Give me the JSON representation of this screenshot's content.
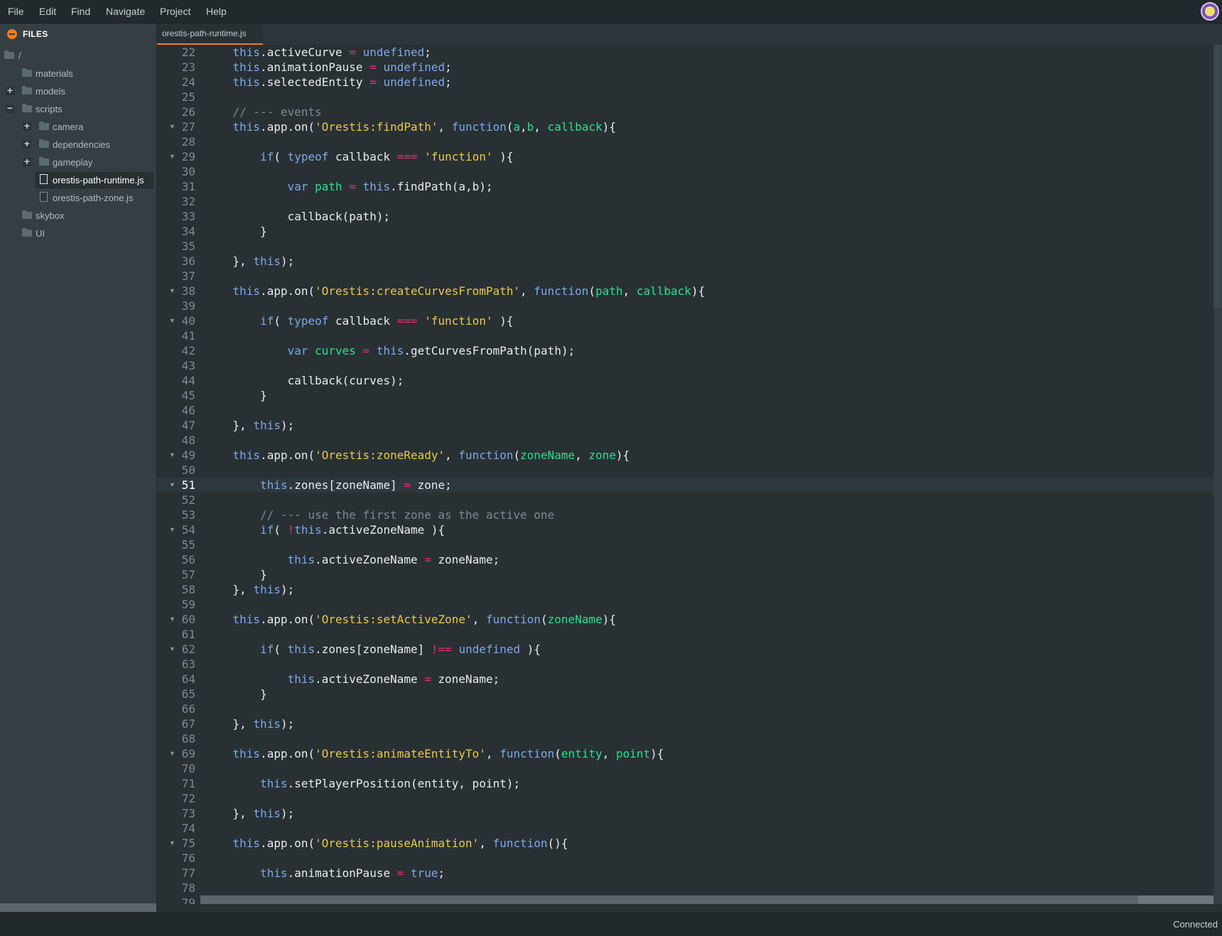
{
  "menubar": {
    "items": [
      "File",
      "Edit",
      "Find",
      "Navigate",
      "Project",
      "Help"
    ]
  },
  "sidebar": {
    "title": "FILES",
    "tree": [
      {
        "label": "/",
        "kind": "folder",
        "depth": 0,
        "toggle": "",
        "icon": "folder-icon"
      },
      {
        "label": "materials",
        "kind": "folder",
        "depth": 1,
        "toggle": "",
        "icon": "folder-icon"
      },
      {
        "label": "models",
        "kind": "folder",
        "depth": 1,
        "toggle": "+",
        "icon": "folder-icon"
      },
      {
        "label": "scripts",
        "kind": "folder",
        "depth": 1,
        "toggle": "−",
        "icon": "folder-icon"
      },
      {
        "label": "camera",
        "kind": "folder",
        "depth": 2,
        "toggle": "+",
        "icon": "folder-icon"
      },
      {
        "label": "dependencies",
        "kind": "folder",
        "depth": 2,
        "toggle": "+",
        "icon": "folder-icon"
      },
      {
        "label": "gameplay",
        "kind": "folder",
        "depth": 2,
        "toggle": "+",
        "icon": "folder-icon"
      },
      {
        "label": "orestis-path-runtime.js",
        "kind": "file",
        "depth": 2,
        "toggle": "",
        "icon": "file-icon",
        "selected": true
      },
      {
        "label": "orestis-path-zone.js",
        "kind": "file",
        "depth": 2,
        "toggle": "",
        "icon": "file-icon"
      },
      {
        "label": "skybox",
        "kind": "folder",
        "depth": 1,
        "toggle": "",
        "icon": "folder-icon"
      },
      {
        "label": "UI",
        "kind": "folder",
        "depth": 1,
        "toggle": "",
        "icon": "folder-icon"
      }
    ]
  },
  "tabs": [
    {
      "label": "orestis-path-runtime.js",
      "active": true
    }
  ],
  "editor": {
    "active_line": 51,
    "lines": [
      {
        "n": 22,
        "fold": false,
        "html": "    <span class=\"kw\">this</span>.activeCurve <span class=\"op\">=</span> <span class=\"kw\">undefined</span>;"
      },
      {
        "n": 23,
        "fold": false,
        "html": "    <span class=\"kw\">this</span>.animationPause <span class=\"op\">=</span> <span class=\"kw\">undefined</span>;"
      },
      {
        "n": 24,
        "fold": false,
        "html": "    <span class=\"kw\">this</span>.selectedEntity <span class=\"op\">=</span> <span class=\"kw\">undefined</span>;"
      },
      {
        "n": 25,
        "fold": false,
        "html": ""
      },
      {
        "n": 26,
        "fold": false,
        "html": "    <span class=\"cmt\">// --- events</span>"
      },
      {
        "n": 27,
        "fold": true,
        "html": "    <span class=\"kw\">this</span>.app.on(<span class=\"str\">'Orestis:findPath'</span>, <span class=\"kw\">function</span>(<span class=\"prm\">a</span>,<span class=\"prm\">b</span>, <span class=\"prm\">callback</span>){"
      },
      {
        "n": 28,
        "fold": false,
        "html": ""
      },
      {
        "n": 29,
        "fold": true,
        "html": "        <span class=\"kw\">if</span>( <span class=\"kw\">typeof</span> callback <span class=\"op\">===</span> <span class=\"str\">'function'</span> ){"
      },
      {
        "n": 30,
        "fold": false,
        "html": ""
      },
      {
        "n": 31,
        "fold": false,
        "html": "            <span class=\"kw\">var</span> <span class=\"prm\">path</span> <span class=\"op\">=</span> <span class=\"kw\">this</span>.findPath(a,b);"
      },
      {
        "n": 32,
        "fold": false,
        "html": ""
      },
      {
        "n": 33,
        "fold": false,
        "html": "            callback(path);"
      },
      {
        "n": 34,
        "fold": false,
        "html": "        }"
      },
      {
        "n": 35,
        "fold": false,
        "html": ""
      },
      {
        "n": 36,
        "fold": false,
        "html": "    }, <span class=\"kw\">this</span>);"
      },
      {
        "n": 37,
        "fold": false,
        "html": ""
      },
      {
        "n": 38,
        "fold": true,
        "html": "    <span class=\"kw\">this</span>.app.on(<span class=\"str\">'Orestis:createCurvesFromPath'</span>, <span class=\"kw\">function</span>(<span class=\"prm\">path</span>, <span class=\"prm\">callback</span>){"
      },
      {
        "n": 39,
        "fold": false,
        "html": ""
      },
      {
        "n": 40,
        "fold": true,
        "html": "        <span class=\"kw\">if</span>( <span class=\"kw\">typeof</span> callback <span class=\"op\">===</span> <span class=\"str\">'function'</span> ){"
      },
      {
        "n": 41,
        "fold": false,
        "html": ""
      },
      {
        "n": 42,
        "fold": false,
        "html": "            <span class=\"kw\">var</span> <span class=\"prm\">curves</span> <span class=\"op\">=</span> <span class=\"kw\">this</span>.getCurvesFromPath(path);"
      },
      {
        "n": 43,
        "fold": false,
        "html": ""
      },
      {
        "n": 44,
        "fold": false,
        "html": "            callback(curves);"
      },
      {
        "n": 45,
        "fold": false,
        "html": "        }"
      },
      {
        "n": 46,
        "fold": false,
        "html": ""
      },
      {
        "n": 47,
        "fold": false,
        "html": "    }, <span class=\"kw\">this</span>);"
      },
      {
        "n": 48,
        "fold": false,
        "html": ""
      },
      {
        "n": 49,
        "fold": true,
        "html": "    <span class=\"kw\">this</span>.app.on(<span class=\"str\">'Orestis:zoneReady'</span>, <span class=\"kw\">function</span>(<span class=\"prm\">zoneName</span>, <span class=\"prm\">zone</span>){"
      },
      {
        "n": 50,
        "fold": false,
        "html": ""
      },
      {
        "n": 51,
        "fold": true,
        "html": "        <span class=\"kw\">this</span>.zones[zoneName] <span class=\"op\">=</span> zone;"
      },
      {
        "n": 52,
        "fold": false,
        "html": ""
      },
      {
        "n": 53,
        "fold": false,
        "html": "        <span class=\"cmt\">// --- use the first zone as the active one</span>"
      },
      {
        "n": 54,
        "fold": true,
        "html": "        <span class=\"kw\">if</span>( <span class=\"op\">!</span><span class=\"kw\">this</span>.activeZoneName ){"
      },
      {
        "n": 55,
        "fold": false,
        "html": ""
      },
      {
        "n": 56,
        "fold": false,
        "html": "            <span class=\"kw\">this</span>.activeZoneName <span class=\"op\">=</span> zoneName;"
      },
      {
        "n": 57,
        "fold": false,
        "html": "        }"
      },
      {
        "n": 58,
        "fold": false,
        "html": "    }, <span class=\"kw\">this</span>);"
      },
      {
        "n": 59,
        "fold": false,
        "html": ""
      },
      {
        "n": 60,
        "fold": true,
        "html": "    <span class=\"kw\">this</span>.app.on(<span class=\"str\">'Orestis:setActiveZone'</span>, <span class=\"kw\">function</span>(<span class=\"prm\">zoneName</span>){"
      },
      {
        "n": 61,
        "fold": false,
        "html": ""
      },
      {
        "n": 62,
        "fold": true,
        "html": "        <span class=\"kw\">if</span>( <span class=\"kw\">this</span>.zones[zoneName] <span class=\"op\">!==</span> <span class=\"kw\">undefined</span> ){"
      },
      {
        "n": 63,
        "fold": false,
        "html": ""
      },
      {
        "n": 64,
        "fold": false,
        "html": "            <span class=\"kw\">this</span>.activeZoneName <span class=\"op\">=</span> zoneName;"
      },
      {
        "n": 65,
        "fold": false,
        "html": "        }"
      },
      {
        "n": 66,
        "fold": false,
        "html": ""
      },
      {
        "n": 67,
        "fold": false,
        "html": "    }, <span class=\"kw\">this</span>);"
      },
      {
        "n": 68,
        "fold": false,
        "html": ""
      },
      {
        "n": 69,
        "fold": true,
        "html": "    <span class=\"kw\">this</span>.app.on(<span class=\"str\">'Orestis:animateEntityTo'</span>, <span class=\"kw\">function</span>(<span class=\"prm\">entity</span>, <span class=\"prm\">point</span>){"
      },
      {
        "n": 70,
        "fold": false,
        "html": ""
      },
      {
        "n": 71,
        "fold": false,
        "html": "        <span class=\"kw\">this</span>.setPlayerPosition(entity, point);"
      },
      {
        "n": 72,
        "fold": false,
        "html": ""
      },
      {
        "n": 73,
        "fold": false,
        "html": "    }, <span class=\"kw\">this</span>);"
      },
      {
        "n": 74,
        "fold": false,
        "html": ""
      },
      {
        "n": 75,
        "fold": true,
        "html": "    <span class=\"kw\">this</span>.app.on(<span class=\"str\">'Orestis:pauseAnimation'</span>, <span class=\"kw\">function</span>(){"
      },
      {
        "n": 76,
        "fold": false,
        "html": ""
      },
      {
        "n": 77,
        "fold": false,
        "html": "        <span class=\"kw\">this</span>.animationPause <span class=\"op\">=</span> <span class=\"kw\">true</span>;"
      },
      {
        "n": 78,
        "fold": false,
        "html": ""
      },
      {
        "n": 79,
        "fold": false,
        "html": "    }, <span class=\"kw\">this</span>);"
      }
    ]
  },
  "status": {
    "text": "Connected"
  },
  "colors": {
    "accent": "#f37b23",
    "keyword": "#7ea8e9",
    "string": "#e9c94b",
    "operator": "#ea2e6e",
    "parameter": "#29e18e",
    "comment": "#7c8a90"
  }
}
